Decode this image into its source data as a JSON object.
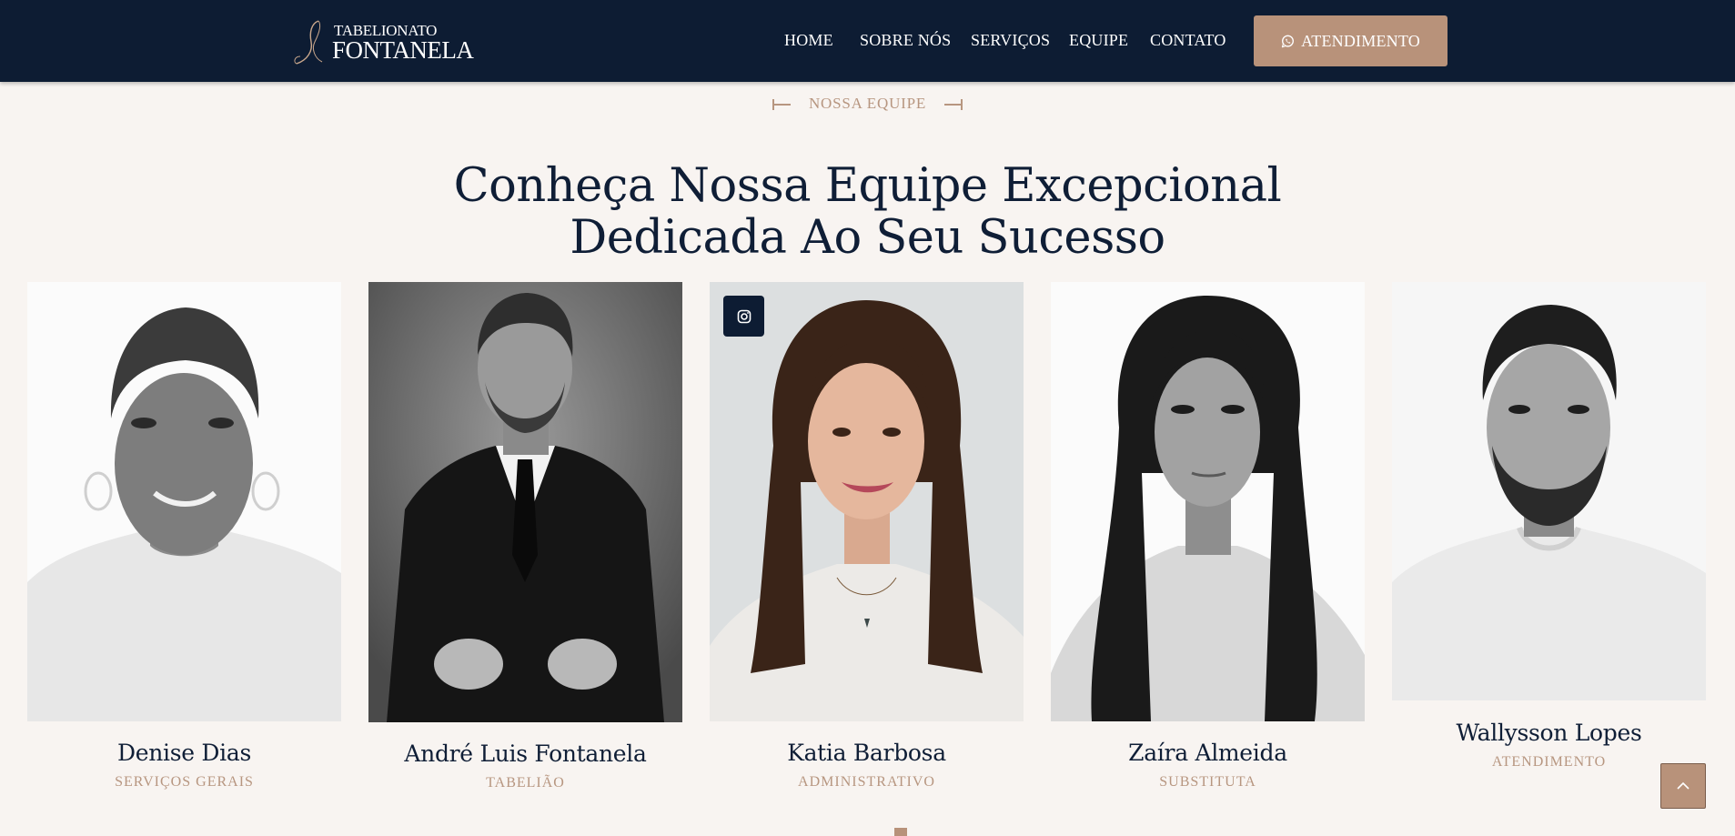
{
  "brand": {
    "line1": "TABELIONATO",
    "line2": "FONTANELA"
  },
  "nav": [
    {
      "label": "HOME"
    },
    {
      "label": "SOBRE NÓS"
    },
    {
      "label": "SERVIÇOS"
    },
    {
      "label": "EQUIPE"
    },
    {
      "label": "CONTATO"
    }
  ],
  "cta": {
    "label": "ATENDIMENTO",
    "icon": "whatsapp-icon"
  },
  "section": {
    "eyebrow": "NOSSA EQUIPE",
    "title_line1": "Conheça Nossa Equipe Excepcional",
    "title_line2": "Dedicada Ao Seu Sucesso"
  },
  "team": [
    {
      "name": "Denise Dias",
      "role": "SERVIÇOS GERAIS"
    },
    {
      "name": "André Luis Fontanela",
      "role": "TABELIÃO"
    },
    {
      "name": "Katia Barbosa",
      "role": "ADMINISTRATIVO",
      "social": "instagram-icon"
    },
    {
      "name": "Zaíra Almeida",
      "role": "SUBSTITUTA"
    },
    {
      "name": "Wallysson Lopes",
      "role": "ATENDIMENTO"
    }
  ],
  "colors": {
    "navy": "#0d1c33",
    "accent": "#b8927a",
    "background": "#f8f4f1"
  }
}
